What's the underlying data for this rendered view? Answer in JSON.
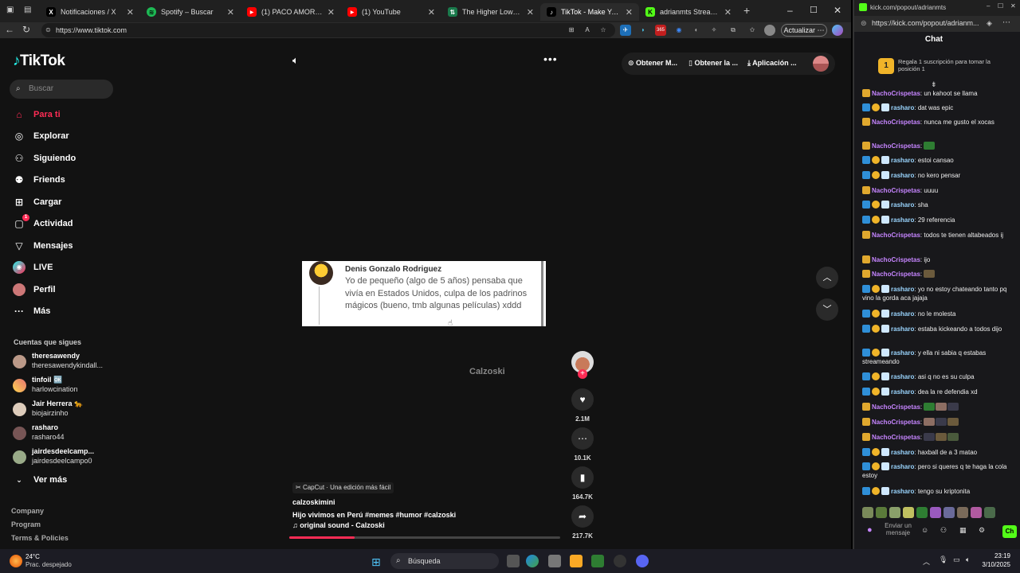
{
  "browser": {
    "tabs": [
      {
        "label": "Notificaciones / X",
        "icon": "x-icon"
      },
      {
        "label": "Spotify – Buscar",
        "icon": "spotify-icon"
      },
      {
        "label": "(1) PACO AMOROSO || BZ",
        "icon": "youtube-icon"
      },
      {
        "label": "(1) YouTube",
        "icon": "youtube-icon"
      },
      {
        "label": "The Higher Lower Game",
        "icon": "game-icon"
      },
      {
        "label": "TikTok - Make Your D",
        "icon": "tiktok-icon"
      },
      {
        "label": "adrianmts Stream - Watc",
        "icon": "kick-icon"
      }
    ],
    "url": "https://www.tiktok.com",
    "update_label": "Actualizar"
  },
  "tiktok": {
    "logo": "TikTok",
    "search_placeholder": "Buscar",
    "nav": [
      {
        "label": "Para ti",
        "icon": "home-icon",
        "active": true
      },
      {
        "label": "Explorar",
        "icon": "compass-icon"
      },
      {
        "label": "Siguiendo",
        "icon": "following-icon"
      },
      {
        "label": "Friends",
        "icon": "friends-icon"
      },
      {
        "label": "Cargar",
        "icon": "upload-icon"
      },
      {
        "label": "Actividad",
        "icon": "activity-icon",
        "badge": "1"
      },
      {
        "label": "Mensajes",
        "icon": "messages-icon"
      },
      {
        "label": "LIVE",
        "icon": "live-icon"
      },
      {
        "label": "Perfil",
        "icon": "profile-icon"
      },
      {
        "label": "Más",
        "icon": "more-icon"
      }
    ],
    "following_header": "Cuentas que sigues",
    "accounts": [
      {
        "name": "theresawendy",
        "handle": "theresawendykindall..."
      },
      {
        "name": "tinfoil 🆗",
        "handle": "harlowcination"
      },
      {
        "name": "Jair Herrera 🐆",
        "handle": "biojairzinho"
      },
      {
        "name": "rasharo",
        "handle": "rasharo44"
      },
      {
        "name": "jairdesdeelcamp...",
        "handle": "jairdesdeelcampo0"
      }
    ],
    "see_more": "Ver más",
    "footer_links": [
      "Company",
      "Program",
      "Terms & Policies"
    ],
    "top_actions": [
      "Obtener M...",
      "Obtener la ...",
      "Aplicación ..."
    ],
    "video": {
      "comment_name": "Denis Gonzalo Rodriguez",
      "comment_text": "Yo de pequeño (algo de 5 años) pensaba que vivía en Estados Unidos, culpa de los padrinos mágicos (bueno, tmb algunas películas) xddd",
      "watermark": "Calzoski",
      "capcut": "CapCut · Una edición más fácil",
      "author": "calzoskimini",
      "caption": "Hijo vivimos en Perú #memes  #humor  #calzoski",
      "sound": "♫ original sound - Calzoski",
      "progress": 0.24,
      "likes": "2.1M",
      "comments": "10.1K",
      "saves": "164.7K",
      "shares": "217.7K"
    }
  },
  "chat": {
    "url": "https://kick.com/popout/adrianm...",
    "tab_title": "kick.com/popout/adrianmts",
    "title": "Chat",
    "sub_badge": "1",
    "sub_text": "Regala 1 suscripción para tomar la posición 1",
    "messages": [
      {
        "user": "NachoCrispetas",
        "text": "un kahoot se llama",
        "type": "nacho"
      },
      {
        "user": "rasharo",
        "text": "dat was epic",
        "type": "rash"
      },
      {
        "user": "NachoCrispetas",
        "text": "nunca me gusto el xocas",
        "type": "nacho"
      },
      {
        "user": "NachoCrispetas",
        "text": "",
        "type": "nacho",
        "emote": 1
      },
      {
        "user": "rasharo",
        "text": "estoi cansao",
        "type": "rash"
      },
      {
        "user": "rasharo",
        "text": "no kero pensar",
        "type": "rash"
      },
      {
        "user": "NachoCrispetas",
        "text": "uuuu",
        "type": "nacho"
      },
      {
        "user": "rasharo",
        "text": "sha",
        "type": "rash"
      },
      {
        "user": "rasharo",
        "text": "29 referencia",
        "type": "rash"
      },
      {
        "user": "NachoCrispetas",
        "text": "todos te tienen altabeados ij",
        "type": "nacho"
      },
      {
        "user": "NachoCrispetas",
        "text": "ijo",
        "type": "nacho"
      },
      {
        "user": "NachoCrispetas",
        "text": "",
        "type": "nacho",
        "emote": 1
      },
      {
        "user": "rasharo",
        "text": "yo no estoy chateando tanto pq vino la gorda aca jajaja",
        "type": "rash"
      },
      {
        "user": "rasharo",
        "text": "no le molesta",
        "type": "rash"
      },
      {
        "user": "rasharo",
        "text": "estaba kickeando a todos dijo",
        "type": "rash"
      },
      {
        "user": "rasharo",
        "text": "y ella ni sabia q estabas streameando",
        "type": "rash"
      },
      {
        "user": "rasharo",
        "text": "asi q no es su culpa",
        "type": "rash"
      },
      {
        "user": "rasharo",
        "text": "dea la re defendia xd",
        "type": "rash"
      },
      {
        "user": "NachoCrispetas",
        "text": "",
        "type": "nacho",
        "emote": 3
      },
      {
        "user": "NachoCrispetas",
        "text": "",
        "type": "nacho",
        "emote": 3
      },
      {
        "user": "NachoCrispetas",
        "text": "",
        "type": "nacho",
        "emote": 3
      },
      {
        "user": "rasharo",
        "text": "haxball de a 3 matao",
        "type": "rash"
      },
      {
        "user": "rasharo",
        "text": "pero si queres q te haga la cola estoy",
        "type": "rash"
      },
      {
        "user": "rasharo",
        "text": "tengo su kriptonita",
        "type": "rash"
      }
    ],
    "input_placeholder": "Enviar un mensaje",
    "send_label": "Ch"
  },
  "taskbar": {
    "temp": "24°C",
    "weather": "Prac. despejado",
    "search": "Búsqueda",
    "time": "23:19",
    "date": "3/10/2025"
  }
}
